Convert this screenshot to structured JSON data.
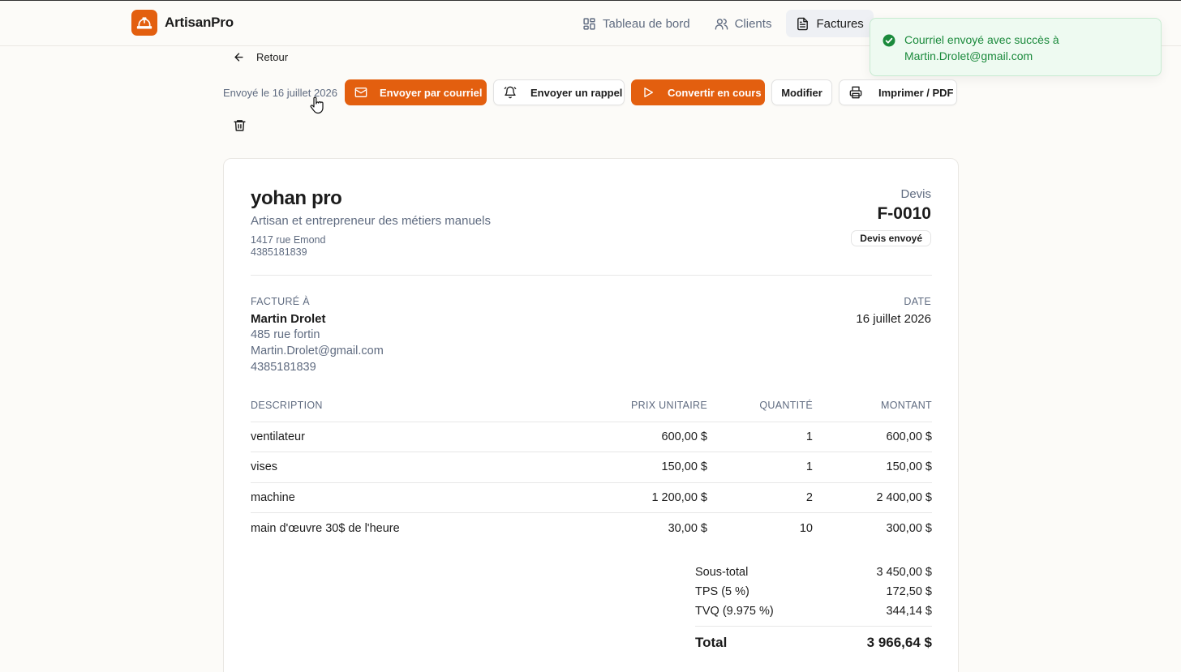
{
  "brand": {
    "name": "ArtisanPro"
  },
  "nav": [
    {
      "label": "Tableau de bord",
      "icon": "dashboard-icon"
    },
    {
      "label": "Clients",
      "icon": "users-icon"
    },
    {
      "label": "Factures",
      "icon": "file-icon",
      "active": true
    }
  ],
  "toast": {
    "message": "Courriel envoyé avec succès à Martin.Drolet@gmail.com",
    "color": "#1b8a3c"
  },
  "back_label": "Retour",
  "actions": {
    "sent_label": "Envoyé le 16 juillet 2026",
    "send_email": "Envoyer par courriel",
    "send_reminder": "Envoyer un rappel",
    "convert": "Convertir en cours",
    "edit": "Modifier",
    "print": "Imprimer / PDF"
  },
  "company": {
    "name": "yohan pro",
    "tagline": "Artisan et entrepreneur des métiers manuels",
    "address": "1417 rue Emond",
    "phone": "4385181839"
  },
  "document": {
    "type": "Devis",
    "number": "F-0010",
    "status": "Devis envoyé"
  },
  "bill_to": {
    "label": "FACTURÉ À",
    "name": "Martin Drolet",
    "address": "485 rue fortin",
    "email": "Martin.Drolet@gmail.com",
    "phone": "4385181839"
  },
  "date": {
    "label": "DATE",
    "value": "16 juillet 2026"
  },
  "table": {
    "headers": [
      "DESCRIPTION",
      "PRIX UNITAIRE",
      "QUANTITÉ",
      "MONTANT"
    ],
    "rows": [
      [
        "ventilateur",
        "600,00 $",
        "1",
        "600,00 $"
      ],
      [
        "vises",
        "150,00 $",
        "1",
        "150,00 $"
      ],
      [
        "machine",
        "1 200,00 $",
        "2",
        "2 400,00 $"
      ],
      [
        "main d'œuvre 30$ de l'heure",
        "30,00 $",
        "10",
        "300,00 $"
      ]
    ]
  },
  "totals": {
    "subtotal_label": "Sous-total",
    "subtotal": "3 450,00 $",
    "tps_label": "TPS (5 %)",
    "tps": "172,50 $",
    "tvq_label": "TVQ (9.975 %)",
    "tvq": "344,14 $",
    "total_label": "Total",
    "total": "3 966,64 $"
  },
  "colors": {
    "accent": "#e35f0f",
    "muted": "#5f6b80"
  }
}
